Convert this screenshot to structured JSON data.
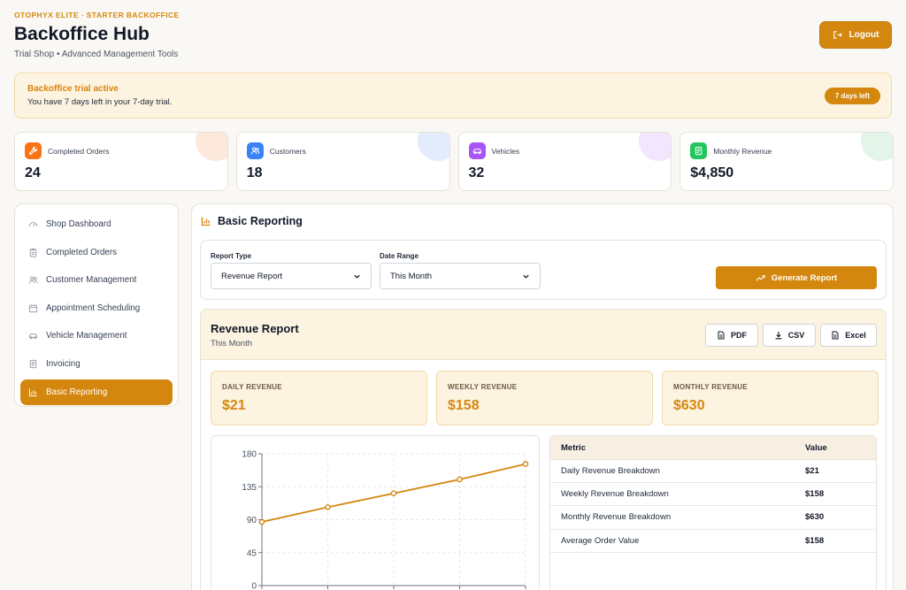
{
  "header": {
    "eyebrow": "OTOPHYX ELITE · STARTER BACKOFFICE",
    "title": "Backoffice Hub",
    "subtitle": "Trial Shop • Advanced Management Tools",
    "logout_label": "Logout"
  },
  "trial": {
    "title": "Backoffice trial active",
    "text": "You have 7 days left in your 7-day trial.",
    "badge": "7 days left"
  },
  "stats": [
    {
      "label": "Completed Orders",
      "value": "24",
      "icon": "wrench-icon",
      "color": "#f97316",
      "tint": "#fde9dc"
    },
    {
      "label": "Customers",
      "value": "18",
      "icon": "users-icon",
      "color": "#3b82f6",
      "tint": "#e3ecfd"
    },
    {
      "label": "Vehicles",
      "value": "32",
      "icon": "car-icon",
      "color": "#a855f7",
      "tint": "#f1e6fd"
    },
    {
      "label": "Monthly Revenue",
      "value": "$4,850",
      "icon": "receipt-icon",
      "color": "#22c55e",
      "tint": "#e2f5e8"
    }
  ],
  "sidebar": {
    "items": [
      {
        "label": "Shop Dashboard",
        "icon": "gauge-icon"
      },
      {
        "label": "Completed Orders",
        "icon": "clipboard-icon"
      },
      {
        "label": "Customer Management",
        "icon": "users-icon"
      },
      {
        "label": "Appointment Scheduling",
        "icon": "calendar-icon"
      },
      {
        "label": "Vehicle Management",
        "icon": "car-icon"
      },
      {
        "label": "Invoicing",
        "icon": "receipt-icon"
      },
      {
        "label": "Basic Reporting",
        "icon": "bar-chart-icon",
        "active": true
      }
    ]
  },
  "main": {
    "title": "Basic Reporting",
    "filters": {
      "report_type_label": "Report Type",
      "report_type_value": "Revenue Report",
      "date_range_label": "Date Range",
      "date_range_value": "This Month",
      "generate_label": "Generate Report"
    },
    "report": {
      "title": "Revenue Report",
      "subtitle": "This Month",
      "exports": [
        "PDF",
        "CSV",
        "Excel"
      ],
      "kpis": [
        {
          "label": "DAILY REVENUE",
          "value": "$21"
        },
        {
          "label": "WEEKLY REVENUE",
          "value": "$158"
        },
        {
          "label": "MONTHLY REVENUE",
          "value": "$630"
        }
      ],
      "table": {
        "headers": [
          "Metric",
          "Value"
        ],
        "rows": [
          [
            "Daily Revenue Breakdown",
            "$21"
          ],
          [
            "Weekly Revenue Breakdown",
            "$158"
          ],
          [
            "Monthly Revenue Breakdown",
            "$630"
          ],
          [
            "Average Order Value",
            "$158"
          ]
        ]
      }
    }
  },
  "chart_data": {
    "type": "line",
    "x": [
      1,
      2,
      3,
      4,
      5
    ],
    "series": [
      {
        "values": [
          87,
          107,
          126,
          145,
          166
        ],
        "color": "#d4870f"
      }
    ],
    "yticks": [
      0,
      45,
      90,
      135,
      180
    ],
    "ylim": [
      0,
      180
    ],
    "grid": true
  },
  "colors": {
    "accent": "#d4870f",
    "background": "#faf8f4"
  }
}
